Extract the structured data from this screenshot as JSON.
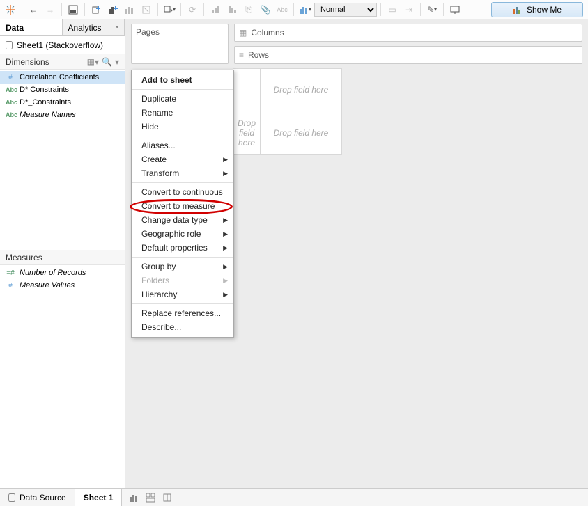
{
  "toolbar": {
    "fit_select": "Normal",
    "showme_label": "Show Me"
  },
  "side_tabs": {
    "data": "Data",
    "analytics": "Analytics"
  },
  "datasource": {
    "name": "Sheet1 (Stackoverflow)"
  },
  "dimensions": {
    "header": "Dimensions",
    "items": [
      {
        "icon": "hash",
        "label": "Correlation Coefficients",
        "selected": true,
        "italic": false
      },
      {
        "icon": "abc",
        "label": "D* Constraints",
        "selected": false,
        "italic": false
      },
      {
        "icon": "abc",
        "label": "D*_Constraints",
        "selected": false,
        "italic": false
      },
      {
        "icon": "abc",
        "label": "Measure Names",
        "selected": false,
        "italic": true
      }
    ]
  },
  "measures": {
    "header": "Measures",
    "items": [
      {
        "icon": "hashg",
        "label": "Number of Records",
        "italic": true
      },
      {
        "icon": "hash",
        "label": "Measure Values",
        "italic": true
      }
    ]
  },
  "shelves": {
    "pages": "Pages",
    "columns": "Columns",
    "rows": "Rows"
  },
  "dropzones": {
    "field_here": "Drop field here",
    "field_here_multiline": "Drop\nfield\nhere"
  },
  "context_menu": {
    "add_to_sheet": "Add to sheet",
    "duplicate": "Duplicate",
    "rename": "Rename",
    "hide": "Hide",
    "aliases": "Aliases...",
    "create": "Create",
    "transform": "Transform",
    "convert_continuous": "Convert to continuous",
    "convert_measure": "Convert to measure",
    "change_data_type": "Change data type",
    "geographic_role": "Geographic role",
    "default_properties": "Default properties",
    "group_by": "Group by",
    "folders": "Folders",
    "hierarchy": "Hierarchy",
    "replace_references": "Replace references...",
    "describe": "Describe..."
  },
  "bottom_tabs": {
    "data_source": "Data Source",
    "sheet1": "Sheet 1"
  }
}
